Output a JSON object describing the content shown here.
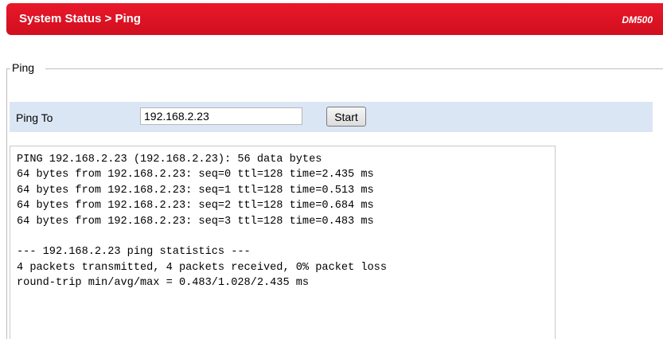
{
  "header": {
    "title": "System Status > Ping",
    "model": "DM500",
    "color": "#e31525"
  },
  "ping_group": {
    "legend": "Ping",
    "ping_to_label": "Ping To",
    "ping_to_value": "192.168.2.23",
    "start_label": "Start"
  },
  "output": {
    "lines": [
      "PING 192.168.2.23 (192.168.2.23): 56 data bytes",
      "64 bytes from 192.168.2.23: seq=0 ttl=128 time=2.435 ms",
      "64 bytes from 192.168.2.23: seq=1 ttl=128 time=0.513 ms",
      "64 bytes from 192.168.2.23: seq=2 ttl=128 time=0.684 ms",
      "64 bytes from 192.168.2.23: seq=3 ttl=128 time=0.483 ms",
      "",
      "--- 192.168.2.23 ping statistics ---",
      "4 packets transmitted, 4 packets received, 0% packet loss",
      "round-trip min/avg/max = 0.483/1.028/2.435 ms"
    ]
  }
}
